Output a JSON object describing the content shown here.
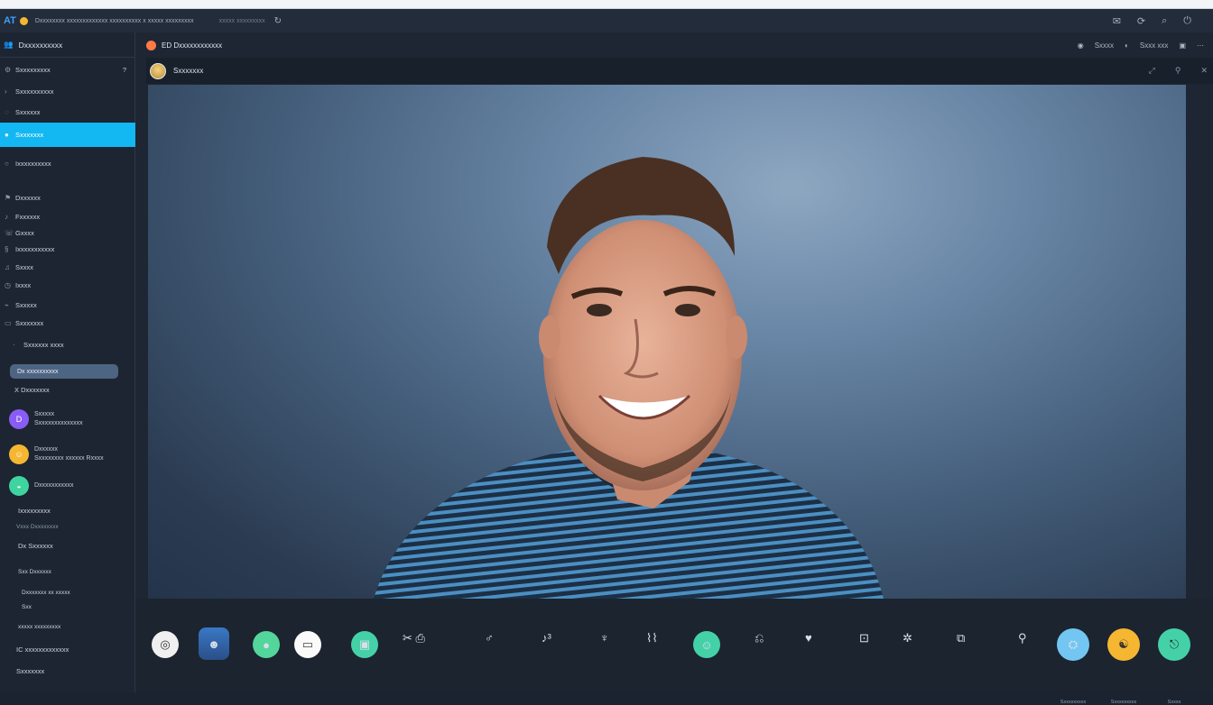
{
  "window": {
    "logo": "AT",
    "title": "Dxxxxxxxx xxxxxxxxxxxxx xxxxxxxxxx x xxxxx xxxxxxxxx",
    "subtitle": "xxxxx xxxxxxxxx"
  },
  "sidebar": {
    "header": "Dxxxxxxxxxx",
    "items": [
      {
        "icon": "gear-icon",
        "label": "Sxxxxxxxxx"
      },
      {
        "icon": "chevron-icon",
        "label": "Sxxxxxxxxxx"
      },
      {
        "icon": "chat-icon",
        "label": "Sxxxxxx"
      },
      {
        "icon": "user-icon",
        "label": "Sxxxxxxx"
      },
      {
        "icon": "mic-icon",
        "label": "Ixxxxxxxxxx"
      },
      {
        "icon": "flag-icon",
        "label": "Dxxxxxx"
      },
      {
        "icon": "bell-icon",
        "label": "Fxxxxxx"
      },
      {
        "icon": "phone-icon",
        "label": "Gxxxx"
      },
      {
        "icon": "settings-icon",
        "label": "Ixxxxxxxxxxx"
      },
      {
        "icon": "music-icon",
        "label": "Sxxxx"
      },
      {
        "icon": "clock-icon",
        "label": "Ixxxx"
      },
      {
        "icon": "chart-icon",
        "label": "Sxxxxx"
      },
      {
        "icon": "folder-icon",
        "label": "Sxxxxxxx"
      },
      {
        "icon": "star-icon",
        "label": "Sxxxxxx xxxx"
      }
    ],
    "pill": "Dx xxxxxxxxxx",
    "subitem": "X  Dxxxxxxx",
    "contacts": [
      {
        "initial": "D",
        "color": "#8a5cf6",
        "name": "Sxxxxx",
        "detail": "Sxxxxxxxxxxxxxx"
      },
      {
        "initial": "",
        "color": "#f5b731",
        "name": "Dxxxxxx",
        "detail": "Sxxxxxxxx xxxxxx Rxxxx"
      },
      {
        "initial": "",
        "color": "#3fd3a0",
        "name": "Dxxxxxxxxxxx",
        "detail": ""
      }
    ],
    "footer": [
      "Ixxxxxxxxx",
      "Vxxx Dxxxxxxxx",
      "Dx Sxxxxxx",
      "Sxx Dxxxxxx",
      "Dxxxxxxx xx xxxxx",
      "Sxx",
      "xxxxx xxxxxxxxx",
      "IC xxxxxxxxxxxxx",
      "Sxxxxxxx"
    ]
  },
  "main": {
    "header": "ED Dxxxxxxxxxxxx",
    "contact": "Sxxxxxxx",
    "right_labels": [
      "Sxxxx",
      "Sxxx xxx"
    ]
  },
  "controls": {
    "labels": [
      "Sxxxxxxxxx",
      "Sxxxxxxxxx",
      "Sxxxx"
    ]
  },
  "colors": {
    "accent": "#13b7f2",
    "sidebar_bg": "#1d2532",
    "main_bg": "#1e2633"
  }
}
